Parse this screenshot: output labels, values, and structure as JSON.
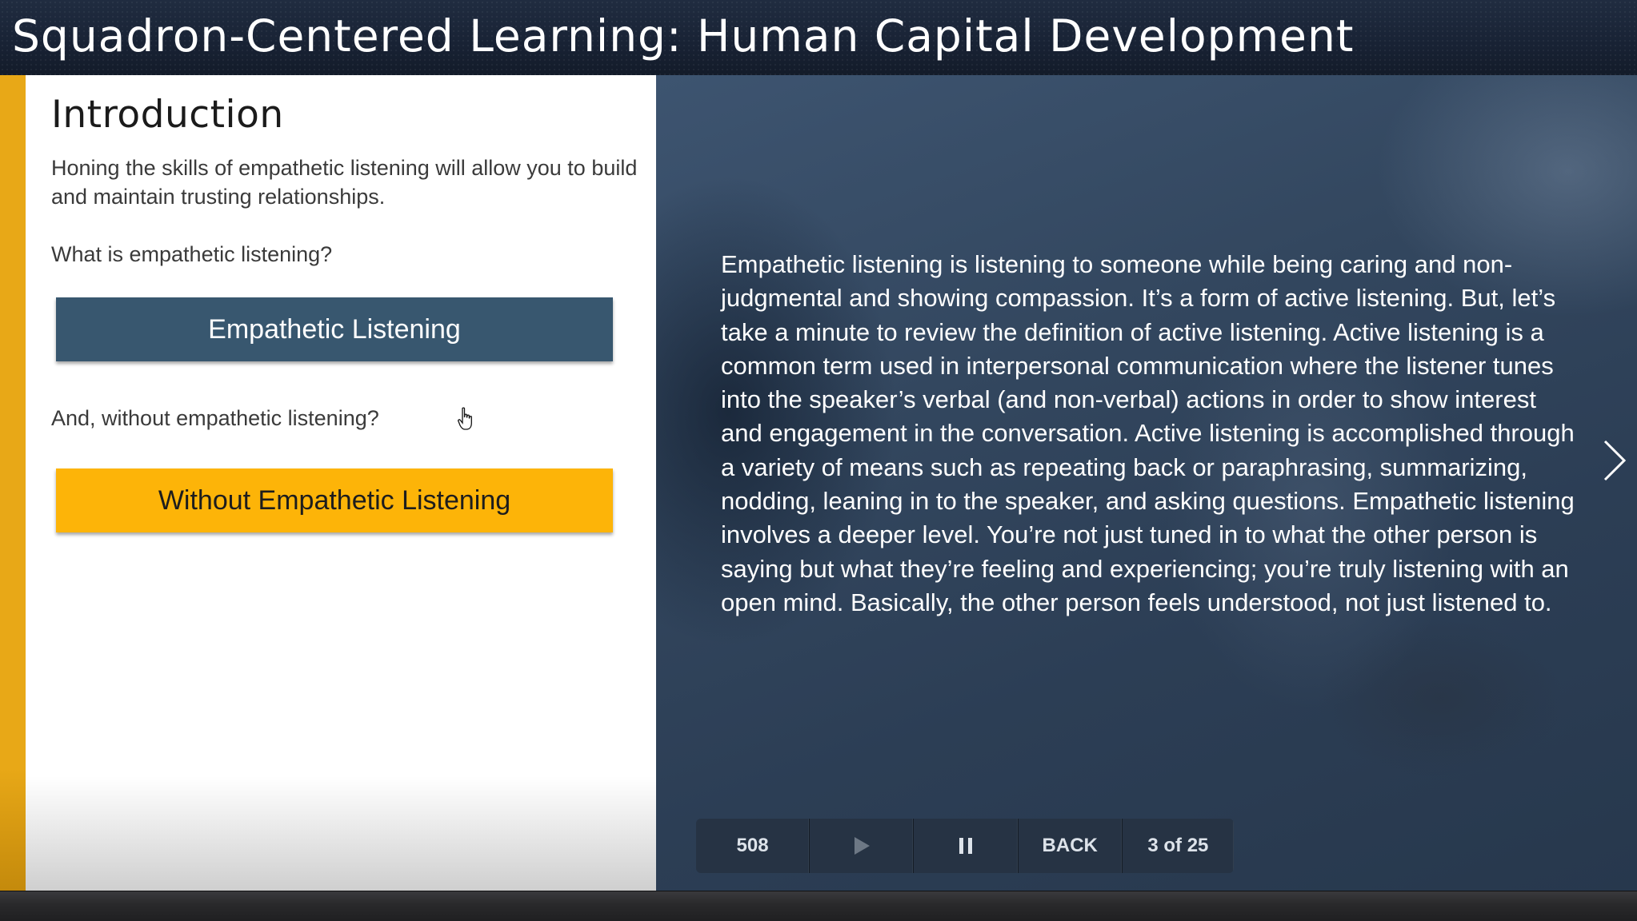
{
  "window": {
    "title": "Squadron-Centered Learning: Human Capital Development"
  },
  "left": {
    "heading": "Introduction",
    "intro": "Honing the skills of empathetic listening will allow you to build and maintain trusting relationships.",
    "question1": "What is empathetic listening?",
    "button1_label": "Empathetic Listening",
    "question2": "And, without empathetic listening?",
    "button2_label": "Without Empathetic Listening"
  },
  "right": {
    "body": "Empathetic listening is listening to someone while being caring and non-judgmental and showing compassion. It’s a form of active listening. But, let’s take a minute to review the definition of active listening. Active listening is a common term used in interpersonal communication where the listener tunes into the speaker’s verbal (and non-verbal) actions in order to show interest and engagement in the conversation. Active listening is accomplished through a variety of means such as repeating back or paraphrasing, summarizing, nodding, leaning in to the speaker, and asking questions. Empathetic listening involves a deeper level. You’re not just tuned in to what the other person is saying but what they’re feeling and experiencing; you’re truly listening with an open mind. Basically, the other person feels understood, not just listened to."
  },
  "controls": {
    "counter": "508",
    "back_label": "BACK",
    "progress": "3 of 25"
  },
  "icons": {
    "play": "play-icon",
    "pause": "pause-icon",
    "next": "chevron-right-icon",
    "cursor": "hand-pointer-icon"
  },
  "colors": {
    "accent_yellow": "#fdb408",
    "button_blue": "#38576f",
    "title_bar": "#1b2537"
  }
}
